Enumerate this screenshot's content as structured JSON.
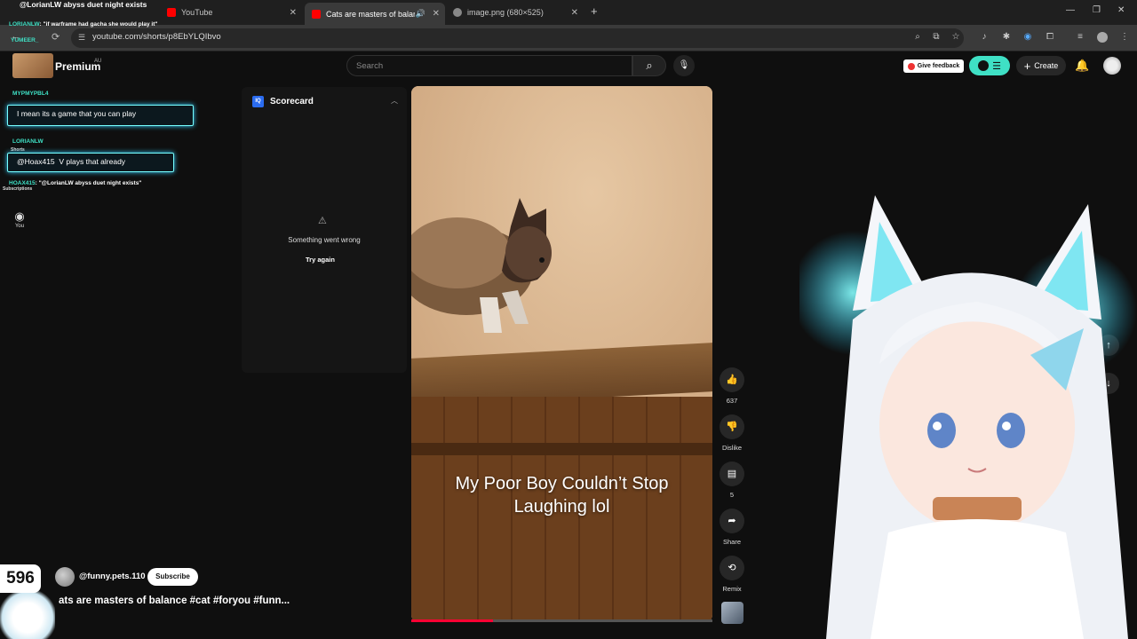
{
  "browser": {
    "tabs": [
      {
        "title": "@LorianLW abyss duet night exists",
        "active": false
      },
      {
        "title": "YouTube",
        "active": false
      },
      {
        "title": "Cats are masters of balance",
        "active": true
      },
      {
        "title": "image.png (680×525)",
        "active": false
      }
    ],
    "url": "youtube.com/shorts/p8EbYLQIbvo"
  },
  "header": {
    "logo_text": "Premium",
    "logo_region": "AU",
    "search_placeholder": "Search",
    "feedback_label": "Give feedback",
    "create_label": "Create"
  },
  "overlay_chat": {
    "line1_user": "LORIANLW",
    "line1_text": ": \"if warframe had gacha she would play it\"",
    "user2": "YUMEER_",
    "user3": "MYPMYPBL4",
    "msg3": "I mean its a game that you can play",
    "user4": "LORIANLW",
    "msg4": "@Hoax415",
    "msg4b": "V plays that already",
    "line5_user": "HOAX415",
    "line5_text": ": \"@LorianLW abyss duet night exists\"",
    "shorts_label": "Shorts",
    "subscriptions_label": "Subscriptions"
  },
  "sidebar": {
    "you_label": "You"
  },
  "scorecard": {
    "title": "Scorecard",
    "error_text": "Something went wrong",
    "retry_label": "Try again"
  },
  "video": {
    "caption_line1": "My Poor Boy Couldn’t Stop",
    "caption_line2": "Laughing lol",
    "progress": 0.27
  },
  "actions": {
    "like_count": "637",
    "dislike_label": "Dislike",
    "comments_count": "5",
    "share_label": "Share",
    "remix_label": "Remix"
  },
  "channel": {
    "handle": "@funny.pets.110",
    "subscribe_label": "Subscribe",
    "title": "ats are masters of balance #cat #foryou #funn..."
  },
  "stream": {
    "viewer_count": "596"
  },
  "colors": {
    "accent_teal": "#3fe0c5",
    "youtube_red": "#ff0033",
    "background": "#0f0f0f"
  }
}
